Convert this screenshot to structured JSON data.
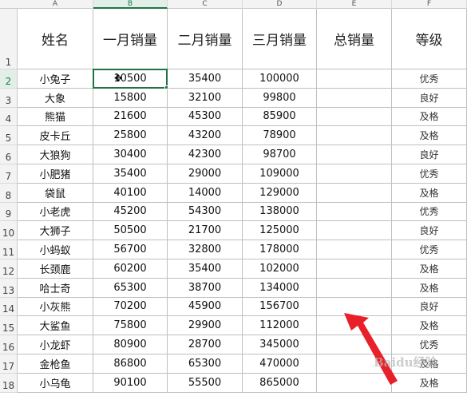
{
  "columns": [
    "A",
    "B",
    "C",
    "D",
    "E",
    "F"
  ],
  "active_column": "B",
  "active_row": 2,
  "headers": [
    "姓名",
    "一月销量",
    "二月销量",
    "三月销量",
    "总销量",
    "等级"
  ],
  "rows": [
    {
      "row": 2,
      "name": "小兔子",
      "jan": "10500",
      "feb": "35400",
      "mar": "100000",
      "total": "",
      "grade": "优秀"
    },
    {
      "row": 3,
      "name": "大象",
      "jan": "15800",
      "feb": "32100",
      "mar": "99800",
      "total": "",
      "grade": "良好"
    },
    {
      "row": 4,
      "name": "熊猫",
      "jan": "21600",
      "feb": "45300",
      "mar": "85900",
      "total": "",
      "grade": "及格"
    },
    {
      "row": 5,
      "name": "皮卡丘",
      "jan": "25800",
      "feb": "43200",
      "mar": "78900",
      "total": "",
      "grade": "及格"
    },
    {
      "row": 6,
      "name": "大狼狗",
      "jan": "30400",
      "feb": "42300",
      "mar": "98700",
      "total": "",
      "grade": "良好"
    },
    {
      "row": 7,
      "name": "小肥猪",
      "jan": "35400",
      "feb": "29000",
      "mar": "109000",
      "total": "",
      "grade": "优秀"
    },
    {
      "row": 8,
      "name": "袋鼠",
      "jan": "40100",
      "feb": "14000",
      "mar": "129000",
      "total": "",
      "grade": "及格"
    },
    {
      "row": 9,
      "name": "小老虎",
      "jan": "45200",
      "feb": "54300",
      "mar": "138000",
      "total": "",
      "grade": "优秀"
    },
    {
      "row": 10,
      "name": "大狮子",
      "jan": "50500",
      "feb": "21700",
      "mar": "125000",
      "total": "",
      "grade": "良好"
    },
    {
      "row": 11,
      "name": "小蚂蚁",
      "jan": "56700",
      "feb": "32800",
      "mar": "178000",
      "total": "",
      "grade": "优秀"
    },
    {
      "row": 12,
      "name": "长颈鹿",
      "jan": "60200",
      "feb": "35400",
      "mar": "102000",
      "total": "",
      "grade": "及格"
    },
    {
      "row": 13,
      "name": "哈士奇",
      "jan": "65300",
      "feb": "38700",
      "mar": "134000",
      "total": "",
      "grade": "及格"
    },
    {
      "row": 14,
      "name": "小灰熊",
      "jan": "70200",
      "feb": "45900",
      "mar": "156700",
      "total": "",
      "grade": "良好"
    },
    {
      "row": 15,
      "name": "大鲨鱼",
      "jan": "75800",
      "feb": "29900",
      "mar": "112000",
      "total": "",
      "grade": "及格"
    },
    {
      "row": 16,
      "name": "小龙虾",
      "jan": "80900",
      "feb": "28700",
      "mar": "345000",
      "total": "",
      "grade": "优秀"
    },
    {
      "row": 17,
      "name": "金枪鱼",
      "jan": "86800",
      "feb": "65300",
      "mar": "470000",
      "total": "",
      "grade": "及格"
    },
    {
      "row": 18,
      "name": "小乌龟",
      "jan": "90100",
      "feb": "55500",
      "mar": "865000",
      "total": "",
      "grade": "及格"
    }
  ],
  "colors": {
    "selection": "#217346",
    "arrow": "#e8202a"
  },
  "watermark": "Baidu经验"
}
